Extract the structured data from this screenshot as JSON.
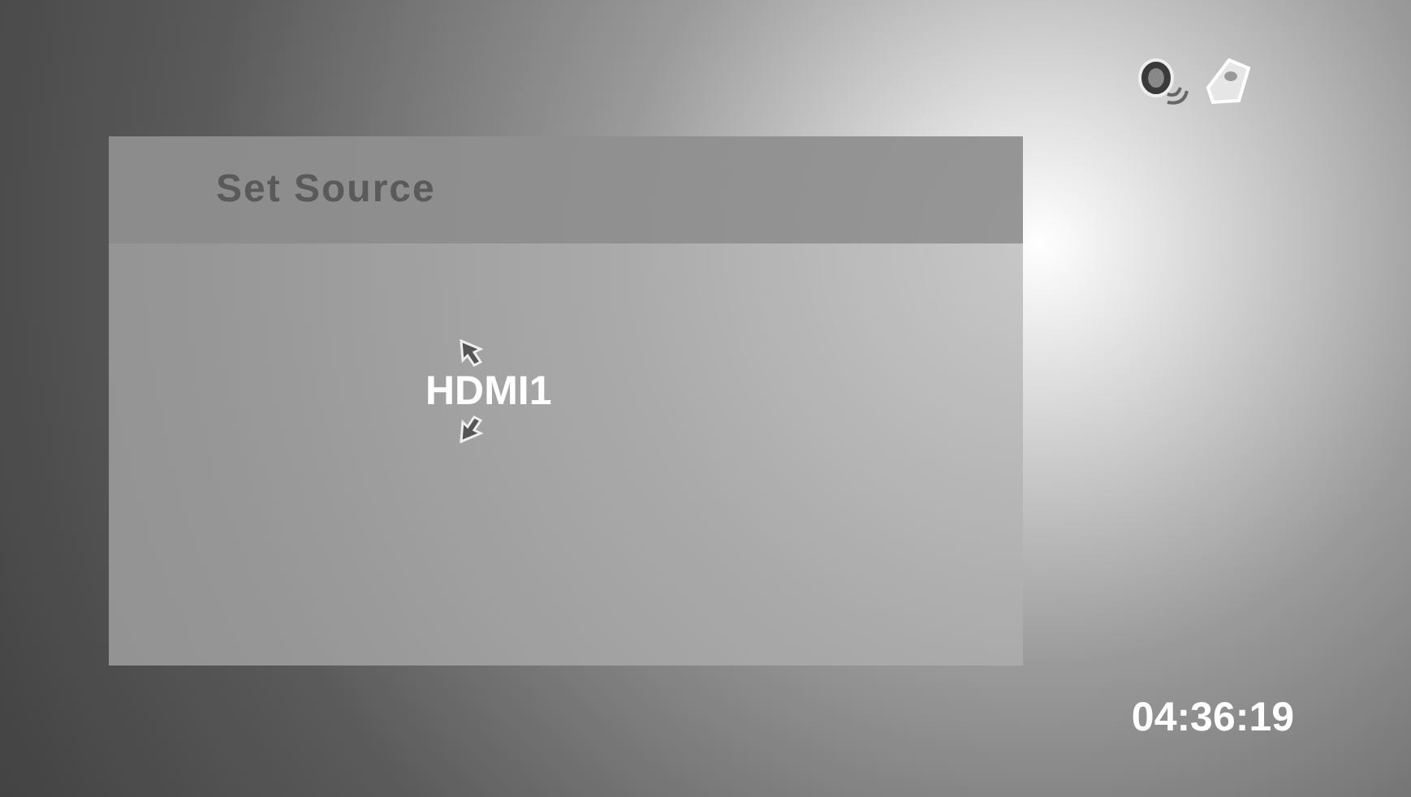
{
  "dialog": {
    "title": "Set Source",
    "value": "HDMI1"
  },
  "clock": "04:36:19"
}
